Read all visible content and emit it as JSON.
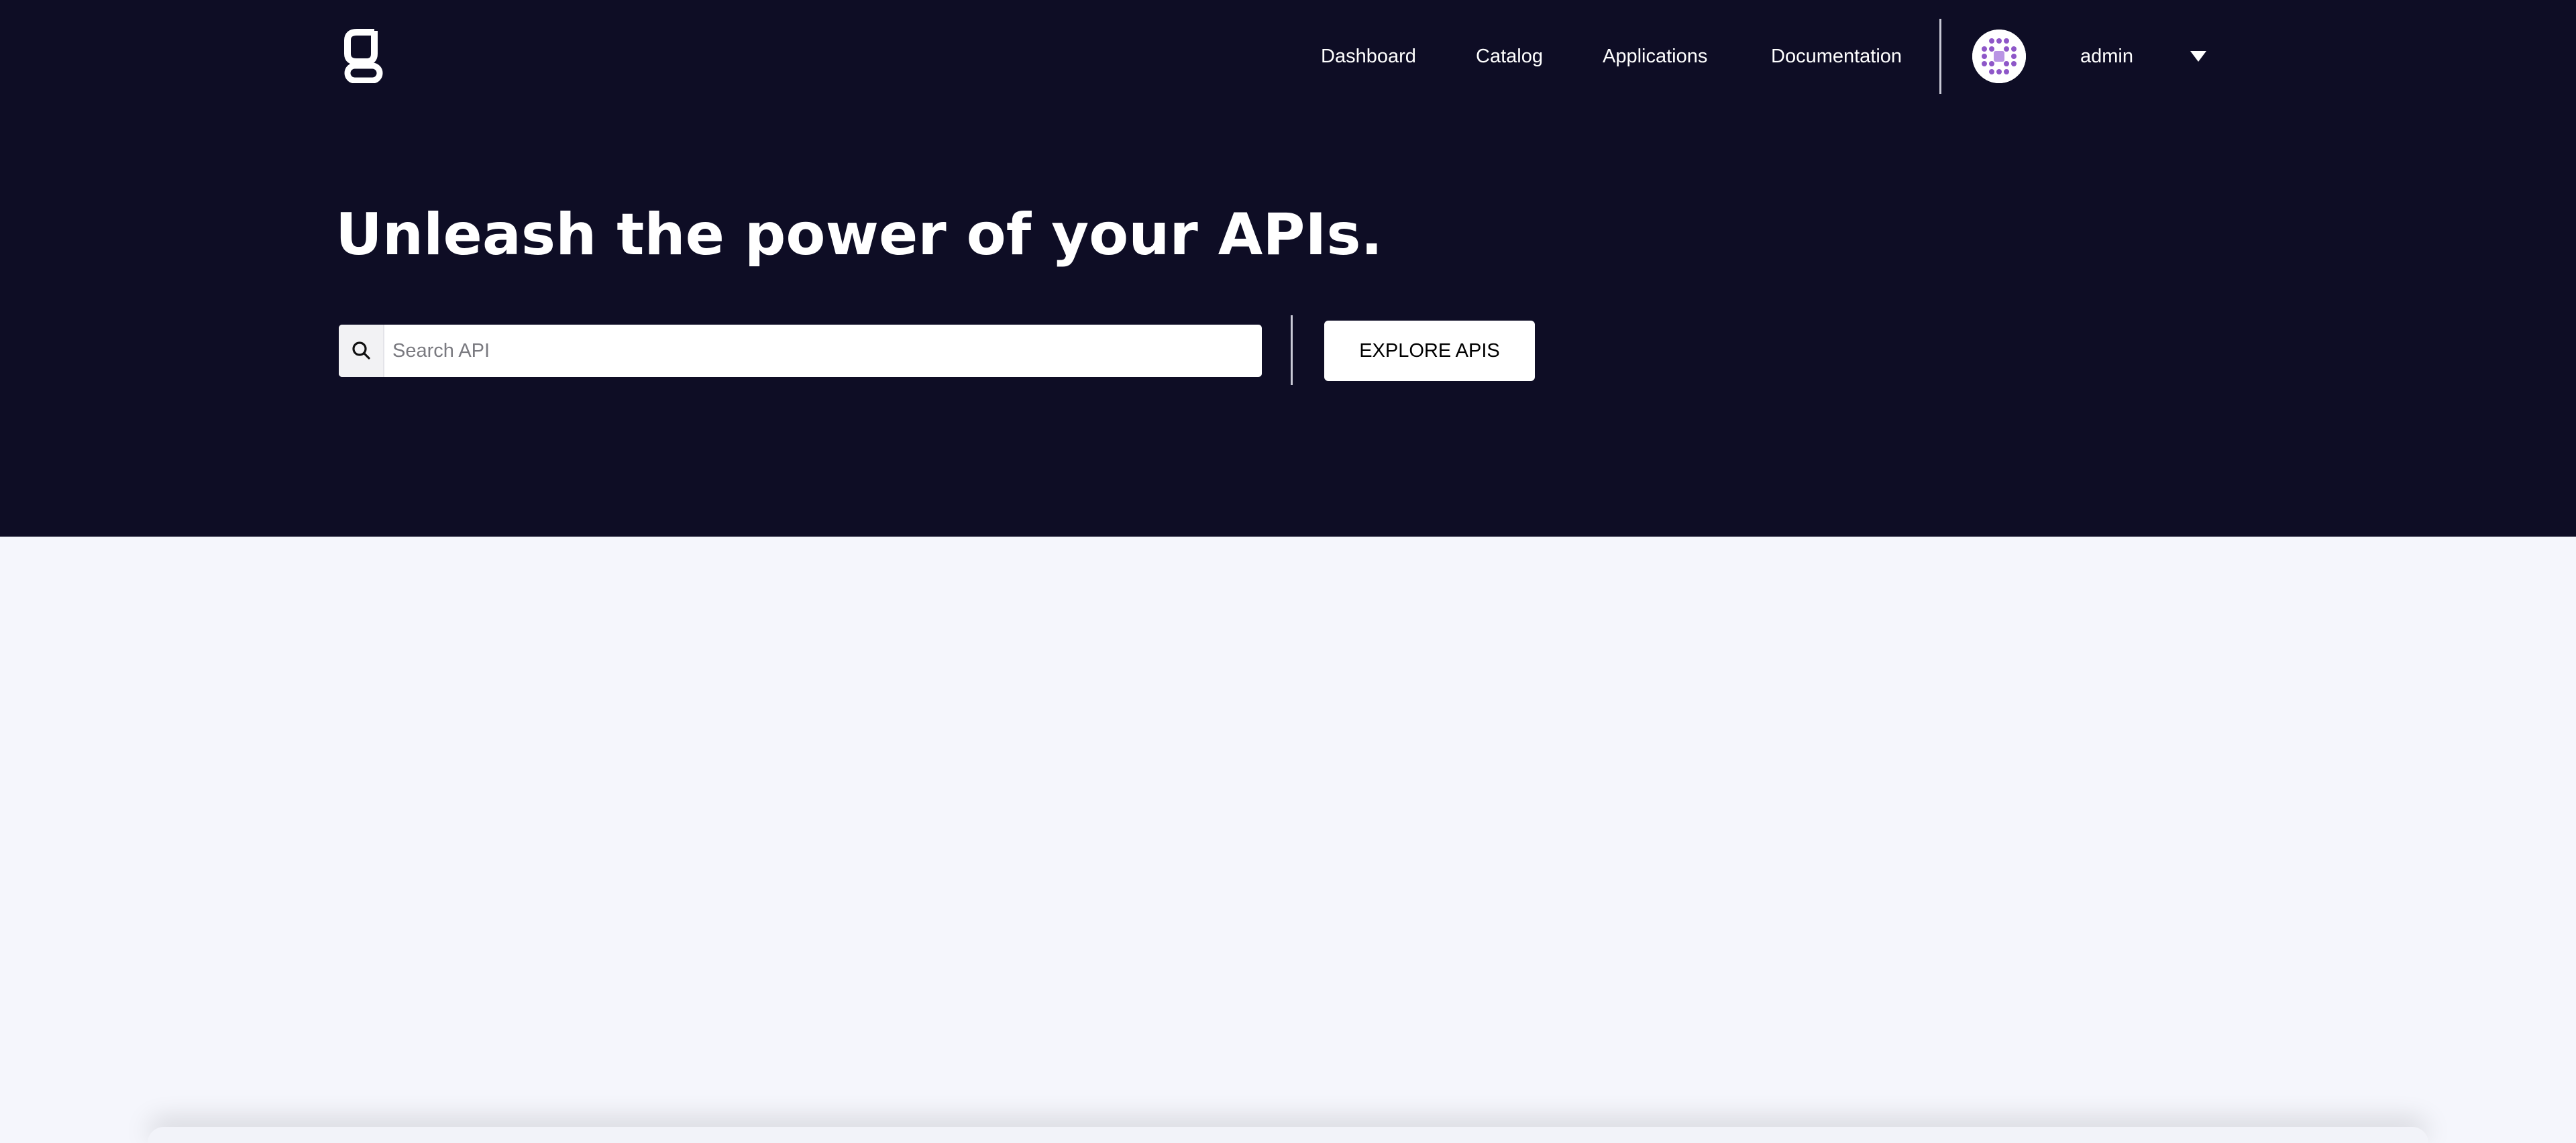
{
  "header": {
    "logo_icon": "gravitee-g-logo-icon",
    "nav": [
      {
        "label": "Dashboard"
      },
      {
        "label": "Catalog"
      },
      {
        "label": "Applications"
      },
      {
        "label": "Documentation"
      }
    ],
    "user": {
      "avatar_icon": "identicon-avatar",
      "name": "admin",
      "menu_icon": "caret-down-icon"
    }
  },
  "hero": {
    "title": "Unleash the power of your APIs.",
    "search": {
      "icon": "search-icon",
      "value": "",
      "placeholder": "Search API"
    },
    "explore_label": "EXPLORE APIS"
  },
  "colors": {
    "header_background": "#0e0d25",
    "page_background": "#f5f6fc",
    "avatar_accent": "#8e57c8"
  }
}
